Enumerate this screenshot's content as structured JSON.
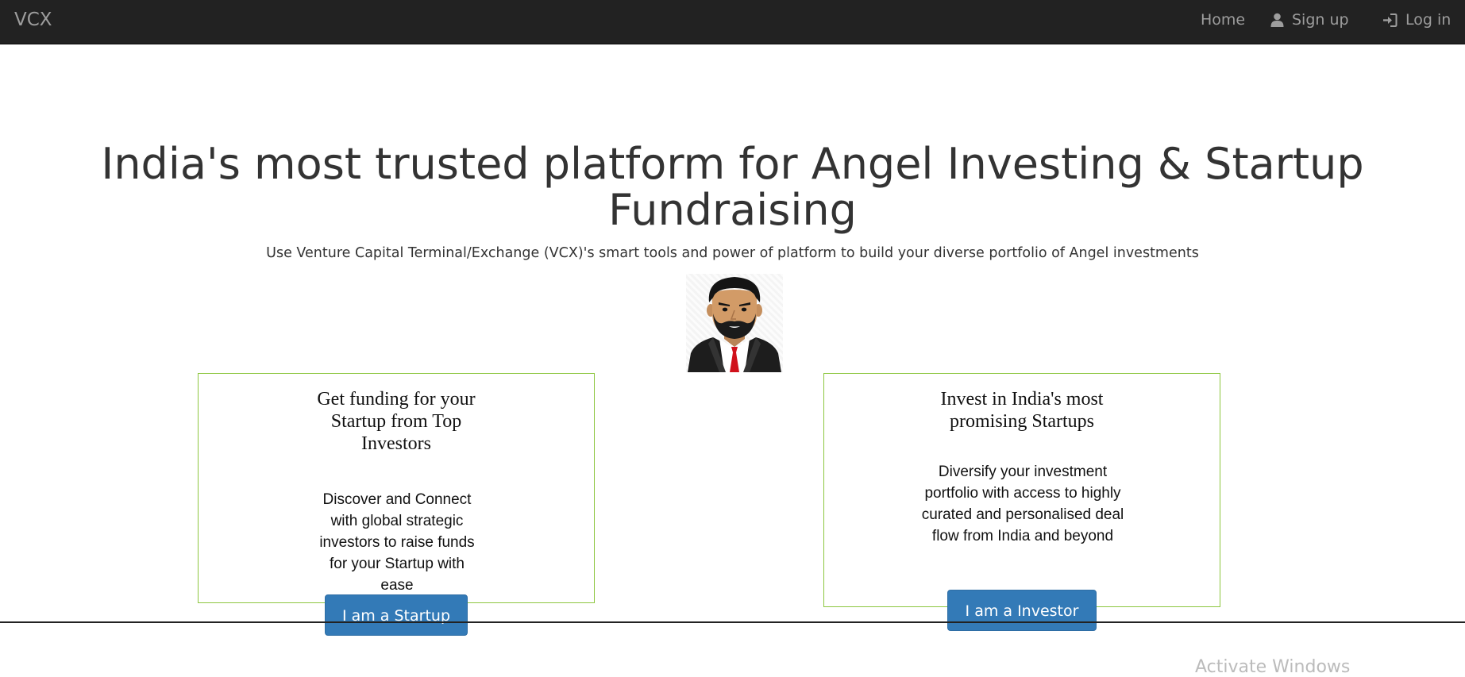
{
  "navbar": {
    "brand": "VCX",
    "home": "Home",
    "signup": "Sign up",
    "login": "Log in"
  },
  "hero": {
    "title": "India's most trusted platform for Angel Investing & Startup Fundraising",
    "subtitle": "Use Venture Capital Terminal/Exchange (VCX)'s smart tools and power of platform to build your diverse portfolio of Angel investments"
  },
  "cards": {
    "startup": {
      "title": "Get funding for your Startup from Top Investors",
      "text": "Discover and Connect with global strategic investors to raise funds for your Startup with ease",
      "button": "I am a Startup"
    },
    "investor": {
      "title": "Invest in India's most promising Startups",
      "text": "Diversify your investment portfolio with access to highly curated and personalised deal flow from India and beyond",
      "button": "I am a Investor"
    }
  },
  "footer": {
    "watermark": "Activate Windows"
  },
  "colors": {
    "navbar_bg": "#222222",
    "nav_text": "#9d9d9d",
    "card_border": "#8dc63f",
    "button_bg": "#337ab7"
  },
  "icons": {
    "signup": "user-icon",
    "login": "log-in-icon",
    "avatar": "businessman-avatar"
  }
}
